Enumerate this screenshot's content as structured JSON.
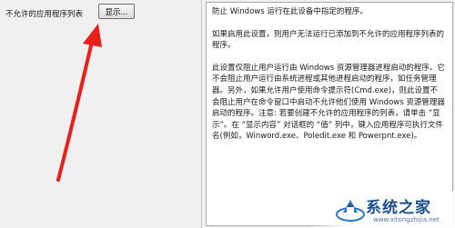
{
  "left": {
    "option_label": "不允许的应用程序列表",
    "show_button_label": "显示..."
  },
  "help": {
    "paragraphs": [
      "防止 Windows 运行在此设备中指定的程序。",
      "如果启用此设置，则用户无法运行已添加到不允许的应用程序列表的程序。",
      "此设置仅阻止用户运行由 Windows 资源管理器进程启动的程序。它不会阻止用户运行由系统进程或其他进程启动的程序，如任务管理器。另外，如果允许用户使用命令提示符(Cmd.exe)，则此设置不会阻止用户在命令窗口中启动不允许他们使用 Windows 资源管理器启动的程序。注意: 若要创建不允许的应用程序的列表，请单击 “显示”。在 “显示内容” 对话框的 “值” 列中，键入应用程序可执行文件名(例如，Winword.exe、Poledit.exe 和 Powerpnt.exe)。"
    ]
  },
  "watermark": {
    "title": "系统之家",
    "url": "www.xitongzhijia.net"
  },
  "colors": {
    "arrow": "#e8201a",
    "watermark_blue": "#1d4f8c"
  }
}
